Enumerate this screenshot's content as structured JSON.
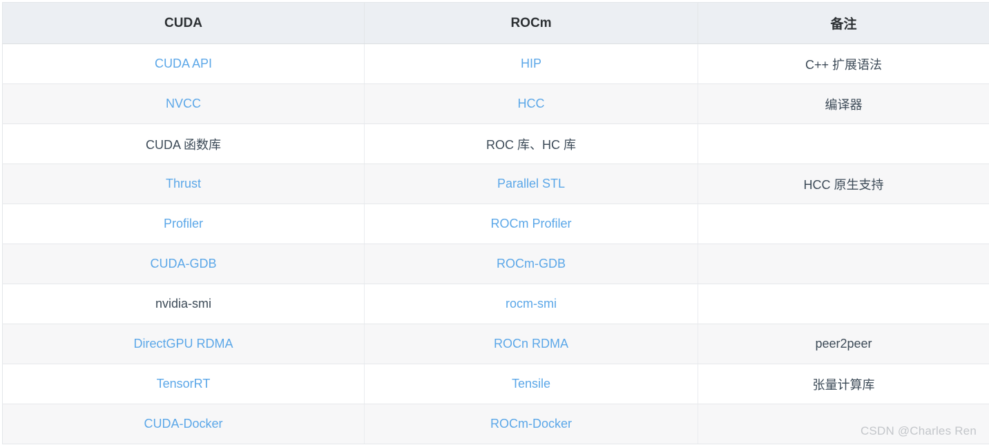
{
  "table": {
    "columns": [
      "CUDA",
      "ROCm",
      "备注"
    ],
    "rows": [
      {
        "cuda": "CUDA API",
        "cuda_style": "link",
        "rocm": "HIP",
        "rocm_style": "link",
        "note": "C++ 扩展语法",
        "note_style": "plain"
      },
      {
        "cuda": "NVCC",
        "cuda_style": "link",
        "rocm": "HCC",
        "rocm_style": "link",
        "note": "编译器",
        "note_style": "plain"
      },
      {
        "cuda": "CUDA 函数库",
        "cuda_style": "plain",
        "rocm": "ROC 库、HC 库",
        "rocm_style": "plain",
        "note": "",
        "note_style": "empty"
      },
      {
        "cuda": "Thrust",
        "cuda_style": "link",
        "rocm": "Parallel STL",
        "rocm_style": "link",
        "note": "HCC 原生支持",
        "note_style": "plain"
      },
      {
        "cuda": "Profiler",
        "cuda_style": "link",
        "rocm": "ROCm Profiler",
        "rocm_style": "link",
        "note": "",
        "note_style": "empty"
      },
      {
        "cuda": "CUDA-GDB",
        "cuda_style": "link",
        "rocm": "ROCm-GDB",
        "rocm_style": "link",
        "note": "",
        "note_style": "empty"
      },
      {
        "cuda": "nvidia-smi",
        "cuda_style": "plain",
        "rocm": "rocm-smi",
        "rocm_style": "link",
        "note": "",
        "note_style": "empty"
      },
      {
        "cuda": "DirectGPU RDMA",
        "cuda_style": "link",
        "rocm": "ROCn RDMA",
        "rocm_style": "link",
        "note": "peer2peer",
        "note_style": "plain"
      },
      {
        "cuda": "TensorRT",
        "cuda_style": "link",
        "rocm": "Tensile",
        "rocm_style": "link",
        "note": "张量计算库",
        "note_style": "plain"
      },
      {
        "cuda": "CUDA-Docker",
        "cuda_style": "link",
        "rocm": "ROCm-Docker",
        "rocm_style": "link",
        "note": "",
        "note_style": "empty"
      }
    ]
  },
  "watermark": {
    "text": "CSDN @Charles Ren"
  },
  "colors": {
    "header_background": "#eceff3",
    "link_text": "#5ba7e8",
    "plain_text": "#3c4a57",
    "stripe_background": "#f7f7f8",
    "border": "#e3e6e9",
    "watermark_text": "#c3c6ca"
  }
}
